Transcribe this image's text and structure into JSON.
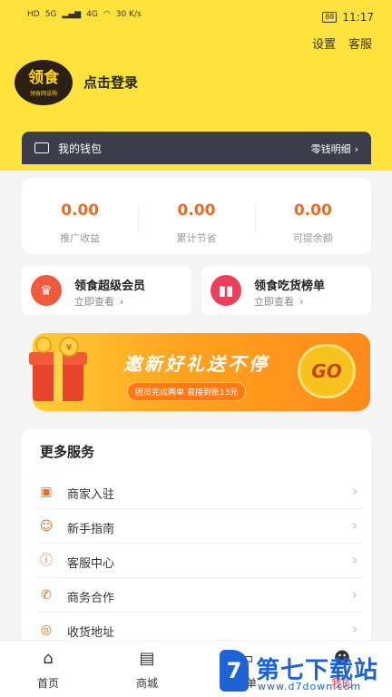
{
  "status_bar": {
    "network_left": [
      "HD",
      "5G",
      "HD",
      "4G"
    ],
    "speed": "30 K/s",
    "battery": "88",
    "time": "11:17"
  },
  "header": {
    "settings": "设置",
    "service": "客服",
    "avatar_title": "领食",
    "avatar_sub": "领食网设购",
    "login": "点击登录"
  },
  "wallet": {
    "title": "我的钱包",
    "link": "零钱明细"
  },
  "stats": [
    {
      "value": "0.00",
      "label": "推广收益"
    },
    {
      "value": "0.00",
      "label": "累计节省"
    },
    {
      "value": "0.00",
      "label": "可提余额"
    }
  ],
  "cards": [
    {
      "title": "领食超级会员",
      "sub": "立即查看",
      "color": "#f05a3c"
    },
    {
      "title": "领食吃货榜单",
      "sub": "立即查看",
      "color": "#ee3f5a"
    }
  ],
  "banner": {
    "title": "邀新好礼送不停",
    "sub": "团员完成两单 直接到账13元",
    "go": "GO"
  },
  "services": {
    "title": "更多服务",
    "items": [
      {
        "label": "商家入驻",
        "icon": "gift-icon"
      },
      {
        "label": "新手指南",
        "icon": "user-icon"
      },
      {
        "label": "客服中心",
        "icon": "info-icon"
      },
      {
        "label": "商务合作",
        "icon": "phone-icon"
      },
      {
        "label": "收货地址",
        "icon": "location-icon"
      }
    ]
  },
  "tabbar": [
    {
      "label": "首页",
      "icon": "home-icon"
    },
    {
      "label": "商城",
      "icon": "shopping-bag-icon"
    },
    {
      "label": "订单",
      "icon": "order-icon"
    },
    {
      "label": "我的",
      "icon": "profile-icon"
    }
  ],
  "watermark": {
    "title": "第七下载站",
    "url": "www.d7down.com",
    "logo": "7"
  },
  "colors": {
    "brand_yellow": "#ffe33c",
    "accent_orange": "#ee6a1d",
    "active_red": "#ee3f3f",
    "wallet_dark": "#3b3d4a",
    "watermark_blue": "#1d63d6"
  }
}
